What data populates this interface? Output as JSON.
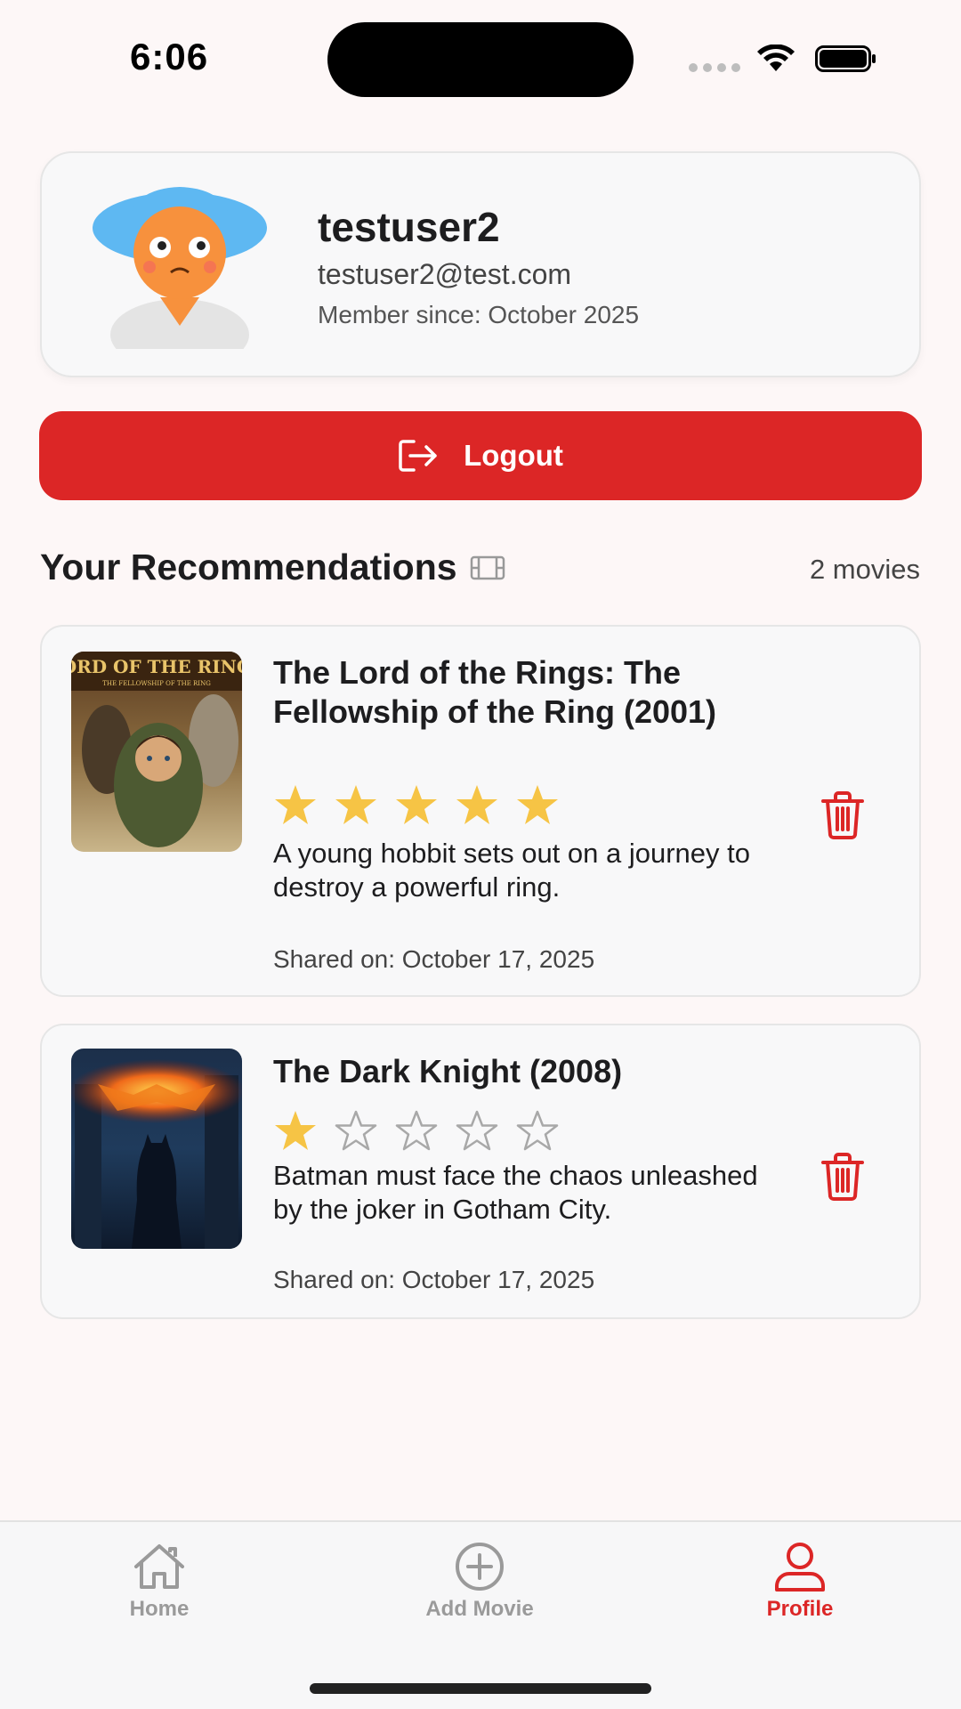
{
  "status_bar": {
    "time": "6:06"
  },
  "profile": {
    "username": "testuser2",
    "email": "testuser2@test.com",
    "member_since": "Member since: October 2025"
  },
  "logout": {
    "label": "Logout"
  },
  "recommendations": {
    "title": "Your Recommendations",
    "count": "2 movies",
    "movies": [
      {
        "title": "The Lord of the Rings: The Fellowship of the Ring (2001)",
        "rating": 5,
        "max_rating": 5,
        "description": "A young hobbit sets out on a journey to destroy a powerful ring.",
        "shared": "Shared on: October 17, 2025",
        "poster_text": "LORD OF THE RINGS",
        "poster_subtext": "THE FELLOWSHIP OF THE RING"
      },
      {
        "title": "The Dark Knight (2008)",
        "rating": 1,
        "max_rating": 5,
        "description": "Batman must face the chaos unleashed by the joker in Gotham City.",
        "shared": "Shared on: October 17, 2025"
      }
    ]
  },
  "tabs": [
    {
      "label": "Home",
      "icon": "home-icon",
      "active": false
    },
    {
      "label": "Add Movie",
      "icon": "add-circle-icon",
      "active": false
    },
    {
      "label": "Profile",
      "icon": "user-icon",
      "active": true
    }
  ],
  "colors": {
    "accent": "#dc2626",
    "star_filled": "#f6c445",
    "star_empty": "#a8a8a8",
    "background": "#fdf7f7"
  }
}
